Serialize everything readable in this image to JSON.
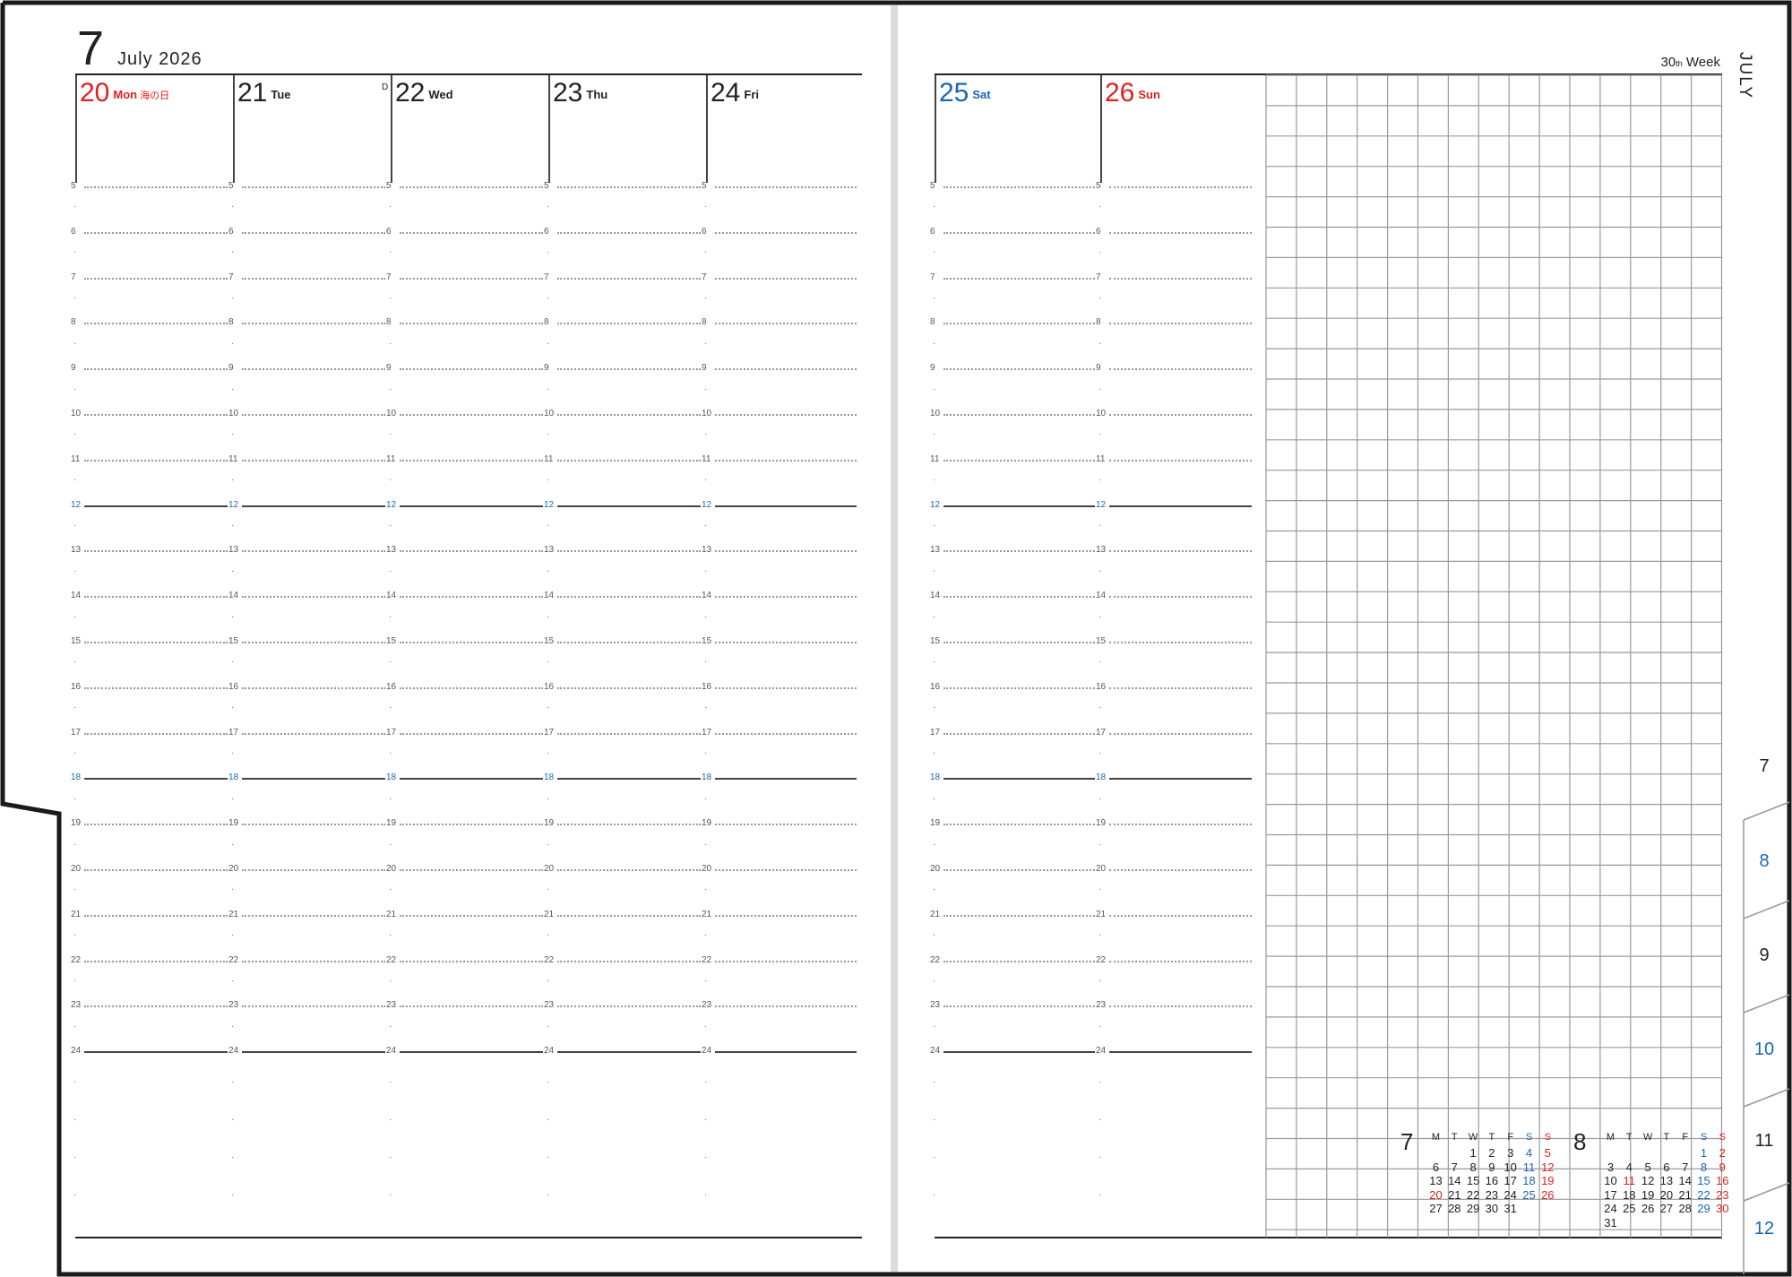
{
  "header": {
    "month_number": "7",
    "month_year": "July 2026",
    "week_label": "30",
    "week_suffix": "th",
    "week_word": "Week",
    "side_label": "JULY"
  },
  "days": [
    {
      "num": "20",
      "weekday": "Mon",
      "holiday": "海の日",
      "color": "#e0201e",
      "mark": ""
    },
    {
      "num": "21",
      "weekday": "Tue",
      "holiday": "",
      "color": "#222222",
      "mark": "D"
    },
    {
      "num": "22",
      "weekday": "Wed",
      "holiday": "",
      "color": "#222222",
      "mark": ""
    },
    {
      "num": "23",
      "weekday": "Thu",
      "holiday": "",
      "color": "#222222",
      "mark": ""
    },
    {
      "num": "24",
      "weekday": "Fri",
      "holiday": "",
      "color": "#222222",
      "mark": ""
    },
    {
      "num": "25",
      "weekday": "Sat",
      "holiday": "",
      "color": "#1a66b5",
      "mark": ""
    },
    {
      "num": "26",
      "weekday": "Sun",
      "holiday": "",
      "color": "#e0201e",
      "mark": ""
    }
  ],
  "hours": [
    "5",
    "6",
    "7",
    "8",
    "9",
    "10",
    "11",
    "12",
    "13",
    "14",
    "15",
    "16",
    "17",
    "18",
    "19",
    "20",
    "21",
    "22",
    "23",
    "24"
  ],
  "highlight_hours": [
    "12",
    "18"
  ],
  "side_tabs": [
    {
      "label": "7",
      "color": "#222222"
    },
    {
      "label": "8",
      "color": "#1a66b5"
    },
    {
      "label": "9",
      "color": "#222222"
    },
    {
      "label": "10",
      "color": "#1a66b5"
    },
    {
      "label": "11",
      "color": "#222222"
    },
    {
      "label": "12",
      "color": "#1a66b5"
    }
  ],
  "mini_calendars": [
    {
      "month": "7",
      "dow": [
        "M",
        "T",
        "W",
        "T",
        "F",
        "S",
        "S"
      ],
      "weeks": [
        [
          "",
          "",
          "1",
          "2",
          "3",
          "4",
          "5"
        ],
        [
          "6",
          "7",
          "8",
          "9",
          "10",
          "11",
          "12"
        ],
        [
          "13",
          "14",
          "15",
          "16",
          "17",
          "18",
          "19"
        ],
        [
          "20",
          "21",
          "22",
          "23",
          "24",
          "25",
          "26"
        ],
        [
          "27",
          "28",
          "29",
          "30",
          "31",
          "",
          ""
        ]
      ],
      "red_dates": [
        "5",
        "12",
        "19",
        "20",
        "26"
      ],
      "blue_dates": [
        "4",
        "11",
        "18",
        "25"
      ]
    },
    {
      "month": "8",
      "dow": [
        "M",
        "T",
        "W",
        "T",
        "F",
        "S",
        "S"
      ],
      "weeks": [
        [
          "",
          "",
          "",
          "",
          "",
          "1",
          "2"
        ],
        [
          "3",
          "4",
          "5",
          "6",
          "7",
          "8",
          "9"
        ],
        [
          "10",
          "11",
          "12",
          "13",
          "14",
          "15",
          "16"
        ],
        [
          "17",
          "18",
          "19",
          "20",
          "21",
          "22",
          "23"
        ],
        [
          "24",
          "25",
          "26",
          "27",
          "28",
          "29",
          "30"
        ],
        [
          "31",
          "",
          "",
          "",
          "",
          "",
          ""
        ]
      ],
      "red_dates": [
        "2",
        "9",
        "11",
        "16",
        "23",
        "30"
      ],
      "blue_dates": [
        "1",
        "8",
        "15",
        "22",
        "29"
      ]
    }
  ],
  "colors": {
    "red": "#e0201e",
    "blue": "#1a66b5",
    "grid": "#9a9a9a",
    "frame": "#1a1a1a"
  }
}
